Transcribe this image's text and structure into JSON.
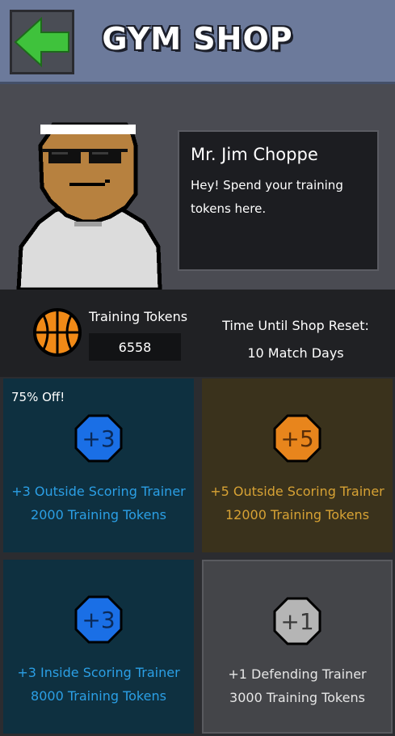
{
  "header": {
    "title": "GYM SHOP",
    "back_icon": "arrow-left-icon",
    "color": "#6c7a9b"
  },
  "npc": {
    "name": "Mr. Jim Choppe",
    "message_line1": "Hey! Spend your training",
    "message_line2": "tokens here."
  },
  "tokens": {
    "label": "Training Tokens",
    "count": "6558",
    "reset_label": "Time Until Shop Reset:",
    "reset_value": "10 Match Days"
  },
  "items": [
    {
      "discount": "75% Off!",
      "badge": "+3",
      "name": "+3 Outside Scoring Trainer",
      "price": "2000 Training Tokens",
      "color": "#2b9fe5"
    },
    {
      "badge": "+5",
      "name": "+5 Outside Scoring Trainer",
      "price": "12000 Training Tokens",
      "color": "#d7a234"
    },
    {
      "badge": "+3",
      "name": "+3 Inside Scoring Trainer",
      "price": "8000 Training Tokens",
      "color": "#2b9fe5"
    },
    {
      "badge": "+1",
      "name": "+1 Defending Trainer",
      "price": "3000 Training Tokens",
      "color": "#e6e6e6"
    }
  ]
}
